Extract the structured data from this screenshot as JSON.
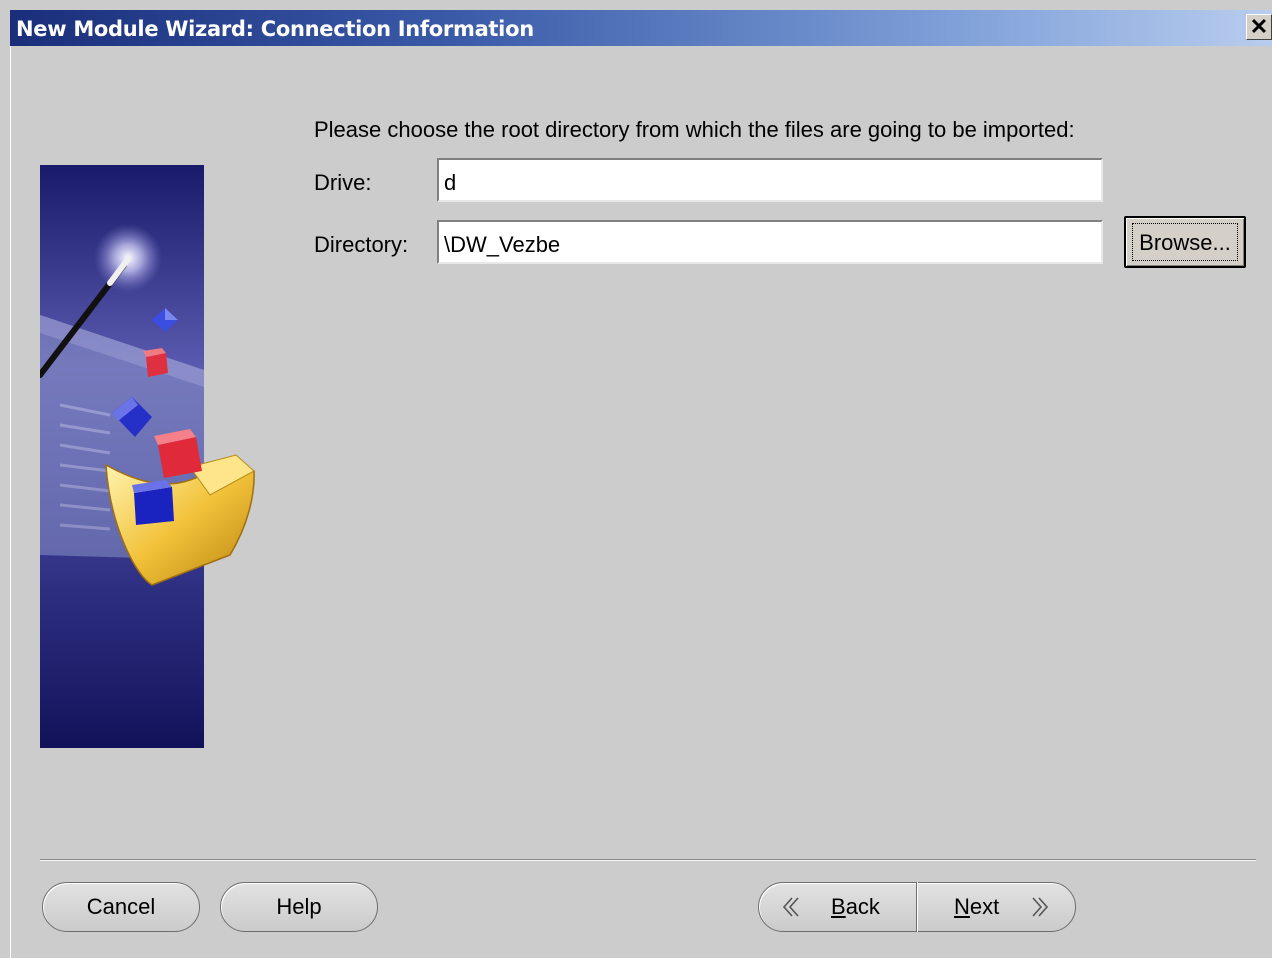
{
  "window": {
    "title": "New Module Wizard: Connection Information",
    "close_symbol": "✕"
  },
  "form": {
    "prompt": "Please choose the root directory from which the files are going to be imported:",
    "drive_label": "Drive:",
    "drive_value": "d",
    "directory_label": "Directory:",
    "directory_value": "\\DW_Vezbe",
    "browse_label": "Browse..."
  },
  "footer": {
    "cancel_label": "Cancel",
    "help_label": "Help",
    "back_mnemonic": "B",
    "back_rest": "ack",
    "next_mnemonic": "N",
    "next_rest": "ext"
  },
  "icons": {
    "wizard_illustration": "wizard-wand-folder-cubes",
    "back": "chevron-left-icon",
    "next": "chevron-right-icon",
    "close": "close-icon"
  },
  "colors": {
    "title_gradient_start": "#1a2e7a",
    "title_gradient_end": "#b8cdee",
    "dialog_bg": "#cccccc",
    "panel_dark": "#1b1b5e"
  }
}
